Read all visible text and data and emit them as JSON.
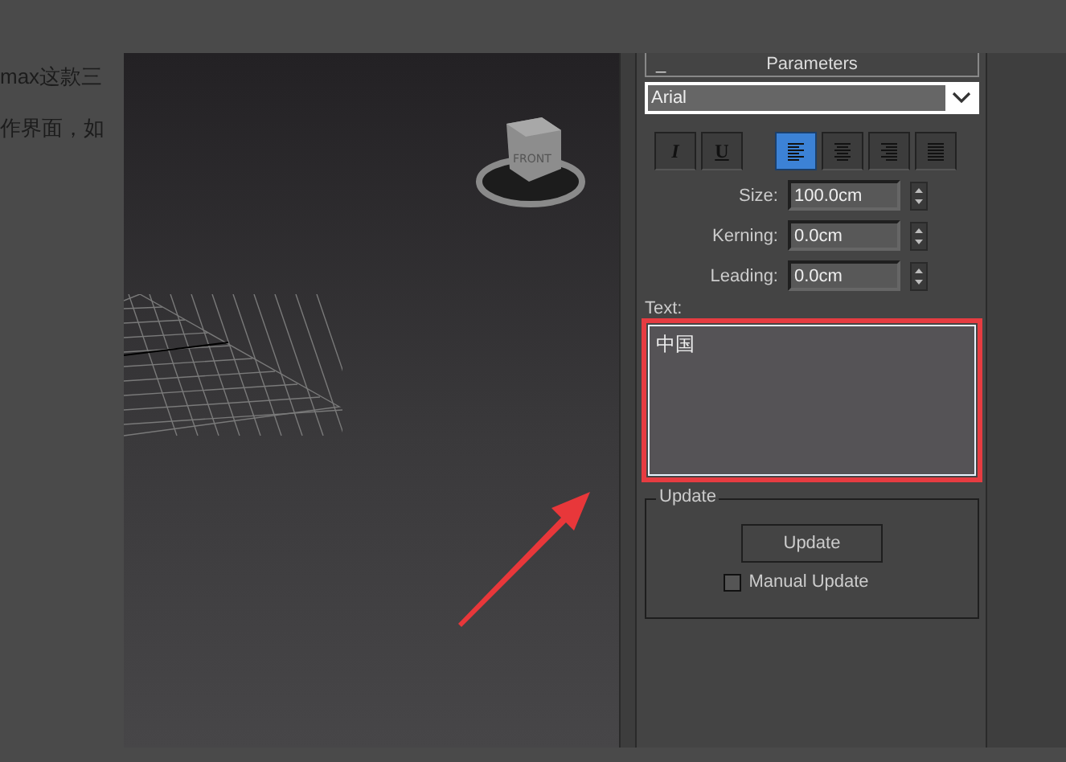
{
  "page_text": [
    "max这款三",
    "作界面，如"
  ],
  "viewport": {
    "view_cube_label": "FRONT"
  },
  "rollout": {
    "collapse": "_",
    "title": "Parameters",
    "font": "Arial",
    "style_buttons": [
      {
        "kind": "italic",
        "label": "I",
        "selected": false
      },
      {
        "kind": "underline",
        "label": "U",
        "selected": false
      }
    ],
    "align_buttons": [
      {
        "kind": "left",
        "selected": true
      },
      {
        "kind": "center",
        "selected": false
      },
      {
        "kind": "right",
        "selected": false
      },
      {
        "kind": "justify",
        "selected": false
      }
    ],
    "spinners": [
      {
        "label": "Size:",
        "value": "100.0cm"
      },
      {
        "label": "Kerning:",
        "value": "0.0cm"
      },
      {
        "label": "Leading:",
        "value": "0.0cm"
      }
    ],
    "text_label": "Text:",
    "text_value": "中国",
    "update_group": {
      "title": "Update",
      "button": "Update",
      "manual_update": {
        "label": "Manual Update",
        "checked": false
      }
    }
  }
}
